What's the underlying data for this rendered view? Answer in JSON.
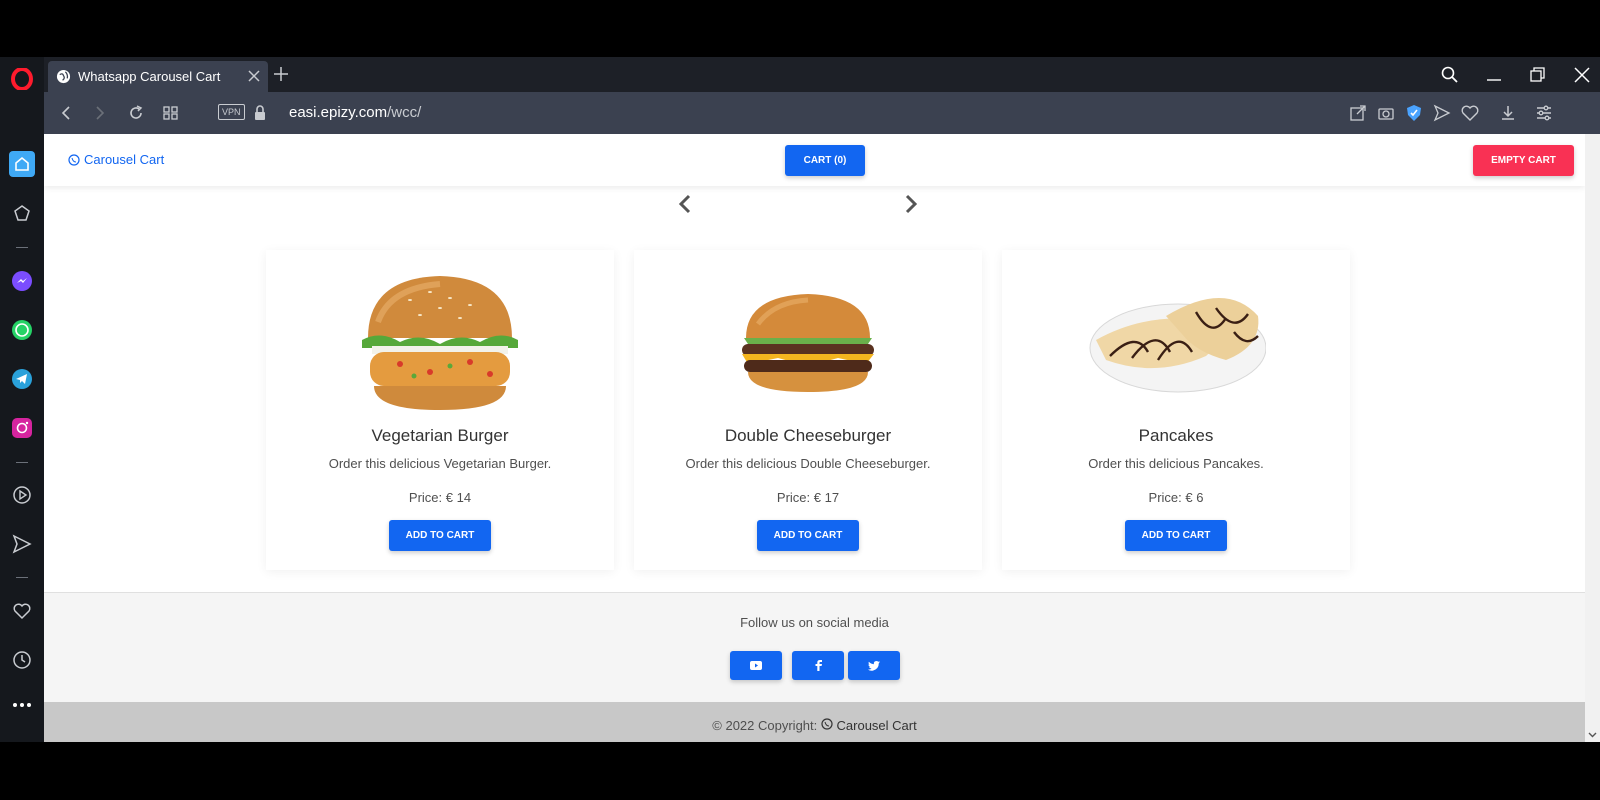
{
  "browser": {
    "tab_title": "Whatsapp Carousel Cart",
    "url_domain": "easi.epizy.com",
    "url_path": "/wcc/",
    "vpn_label": "VPN"
  },
  "sidebar": {
    "items": [
      "opera-logo",
      "home",
      "bookmarks",
      "messenger",
      "whatsapp",
      "telegram",
      "instagram",
      "player",
      "flow",
      "favorites",
      "history",
      "more"
    ]
  },
  "navbar": {
    "brand": "Carousel Cart",
    "cart_label": "CART (0)",
    "empty_label": "EMPTY CART"
  },
  "products": [
    {
      "title": "Vegetarian Burger",
      "desc": "Order this delicious Vegetarian Burger.",
      "price": "Price: € 14",
      "button": "ADD TO CART"
    },
    {
      "title": "Double Cheeseburger",
      "desc": "Order this delicious Double Cheeseburger.",
      "price": "Price: € 17",
      "button": "ADD TO CART"
    },
    {
      "title": "Pancakes",
      "desc": "Order this delicious Pancakes.",
      "price": "Price: € 6",
      "button": "ADD TO CART"
    }
  ],
  "footer": {
    "follow_text": "Follow us on social media",
    "social": [
      "youtube",
      "facebook",
      "twitter"
    ],
    "copyright_prefix": "© 2022 Copyright:",
    "copyright_brand": "Carousel Cart"
  },
  "colors": {
    "primary": "#1266f1",
    "danger": "#f93154",
    "browser_dark": "#1d2027",
    "browser_bar": "#3b4150"
  }
}
